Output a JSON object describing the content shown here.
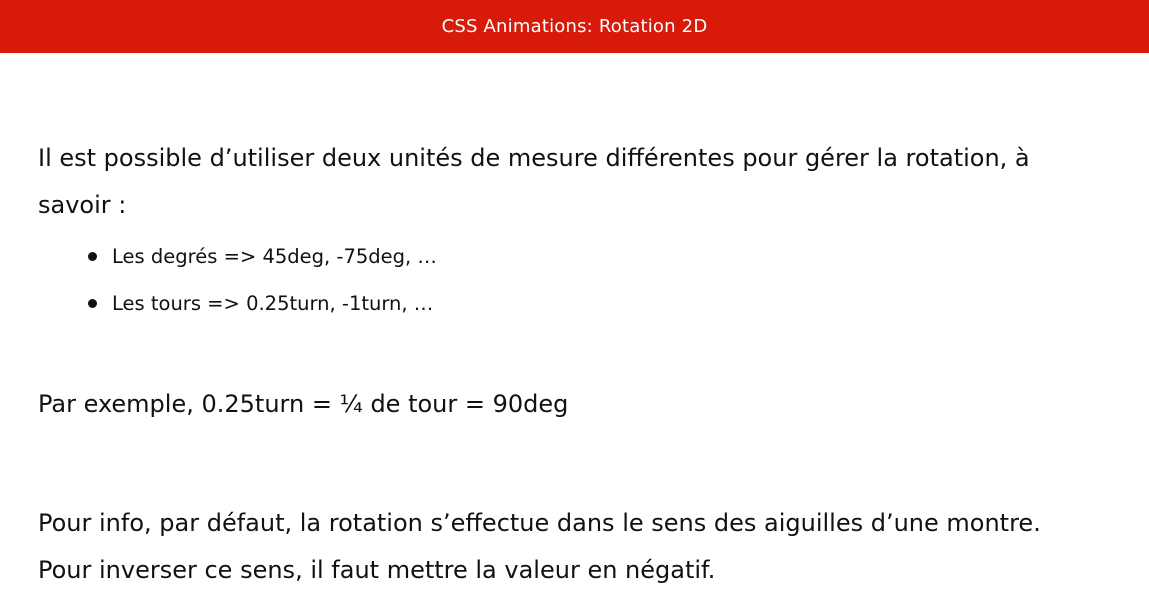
{
  "header": {
    "title": "CSS Animations: Rotation 2D",
    "background_color": "#d71a0a"
  },
  "main": {
    "intro_line1": "Il est possible d’utiliser deux unités de mesure différentes pour gérer la rotation, à",
    "intro_line2": "savoir :",
    "bullets": [
      {
        "text": "Les degrés => 45deg, -75deg, …"
      },
      {
        "text": "Les tours => 0.25turn, -1turn, …"
      }
    ],
    "example": "Par exemple, 0.25turn = ¼ de tour = 90deg",
    "info_line1": "Pour info, par défaut, la rotation s’effectue dans le sens des aiguilles d’une montre.",
    "info_line2": "Pour inverser ce sens, il faut mettre la valeur en négatif."
  }
}
